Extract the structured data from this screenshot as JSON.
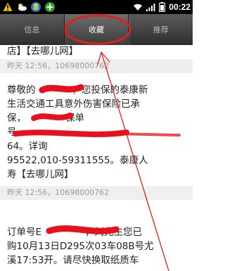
{
  "status_bar": {
    "time": "00:22",
    "icons": [
      "alert-triangle-icon",
      "weather-cloud-icon",
      "android-app-icon",
      "green-plus-icon",
      "wifi-icon",
      "signal-icon",
      "battery-icon"
    ],
    "colors": {
      "background": "#000000"
    }
  },
  "tabs": [
    {
      "label": "信息",
      "active": false
    },
    {
      "label": "收藏",
      "active": true
    },
    {
      "label": "推荐",
      "active": false
    }
  ],
  "messages": [
    {
      "body": "店】【去哪儿网】",
      "meta": "昨天 12:56，10698000762"
    },
    {
      "body_lines": [
        "尊敬的",
        "，您投保的泰康新",
        "生活交通工具意外伤害保险已承",
        "保，",
        "保单",
        "号",
        "64。详询",
        "95522,010-59311555。泰康人",
        "寿【去哪儿网】"
      ],
      "meta": "昨天 12:56，10698000762"
    },
    {
      "body_lines": [
        "订单号E",
        "，刘先生您已",
        "购10月13日D295次03车08B号尤",
        "溪17:53开。请尽快换取纸质车"
      ]
    }
  ],
  "annotation": {
    "circle_color": "#e0201a",
    "arrow_color": "#e0201a",
    "redaction_color": "#e8101a"
  }
}
